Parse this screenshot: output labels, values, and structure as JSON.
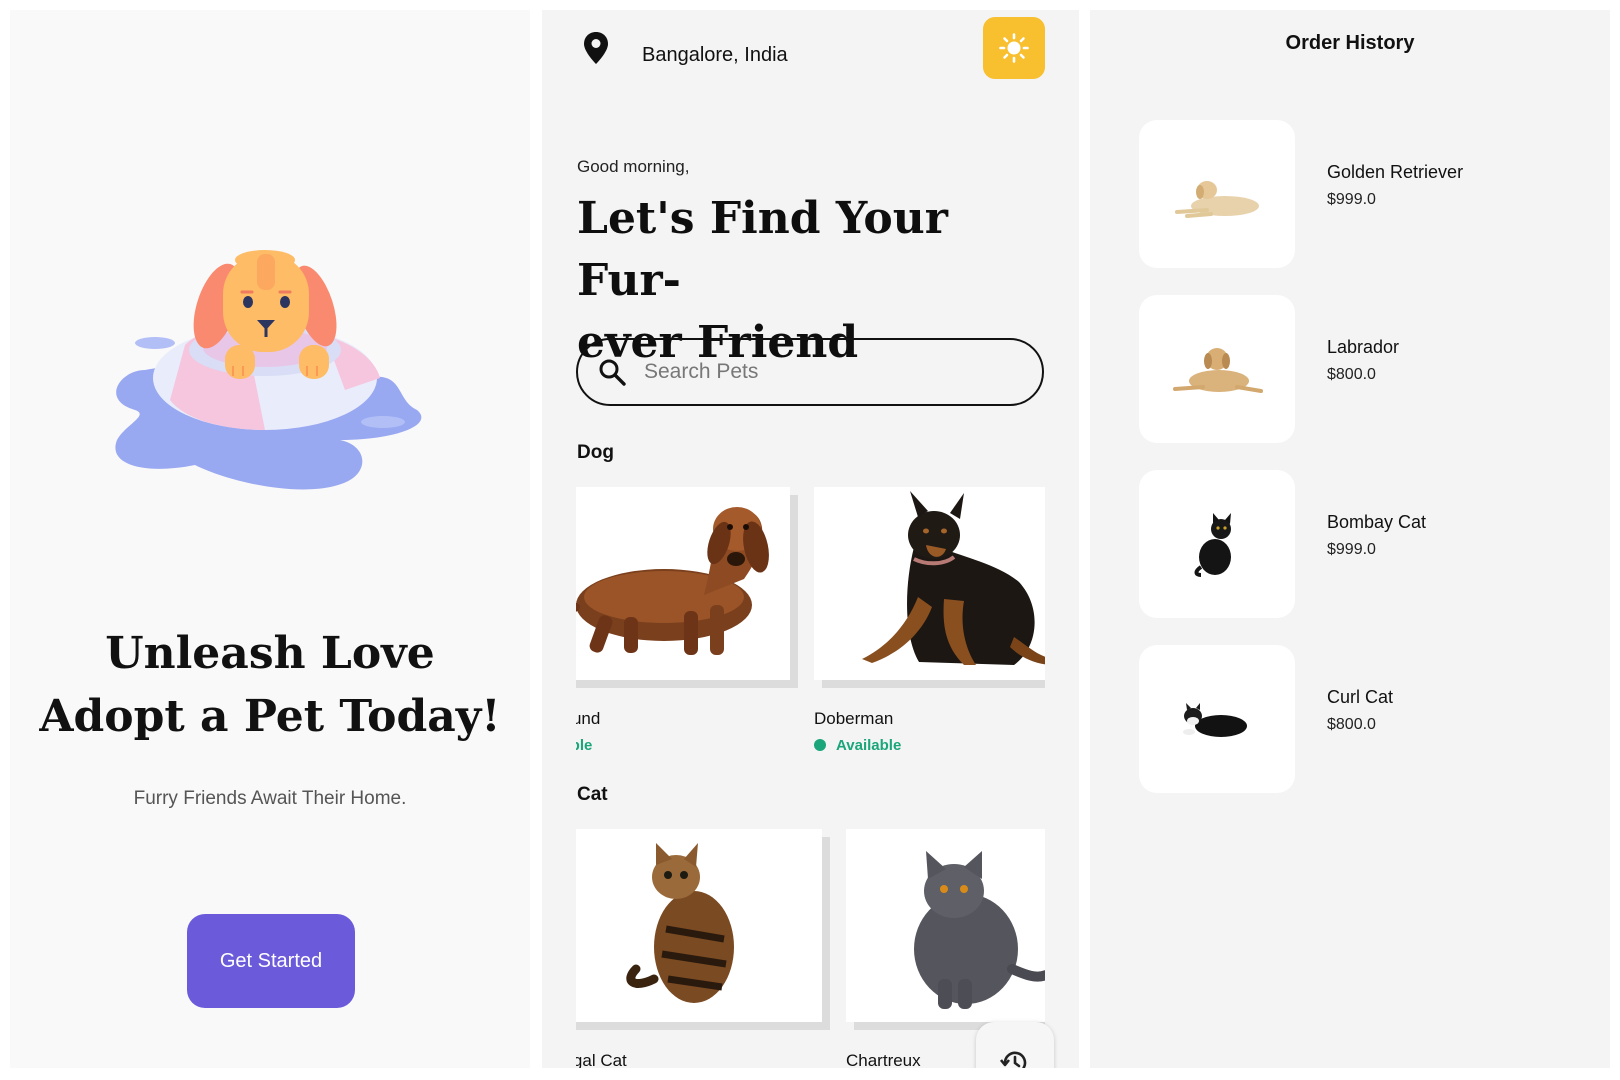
{
  "onboarding": {
    "headline_line1": "Unleash Love",
    "headline_line2": "Adopt a Pet Today!",
    "subtitle": "Furry Friends Await Their Home.",
    "cta_label": "Get Started",
    "hero_icon": "puppy-on-float-illustration",
    "accent_color": "#6b5bdb"
  },
  "home": {
    "location": "Bangalore, India",
    "location_icon": "map-pin-icon",
    "theme_icon": "sun-icon",
    "theme_color": "#f8bf2e",
    "greeting": "Good morning,",
    "title_line1": "Let's Find Your Fur-",
    "title_line2": "ever Friend",
    "search": {
      "placeholder": "Search Pets",
      "value": ""
    },
    "categories": [
      {
        "name": "Dog",
        "pets": [
          {
            "name": "Dachshund",
            "visible_name": "shund",
            "status": "Available",
            "visible_status": "ilable"
          },
          {
            "name": "Doberman",
            "visible_name": "Doberman",
            "status": "Available",
            "visible_status": "Available"
          }
        ]
      },
      {
        "name": "Cat",
        "pets": [
          {
            "name": "Bengal Cat",
            "visible_name": "engal Cat"
          },
          {
            "name": "Chartreux",
            "visible_name": "Chartreux"
          }
        ]
      }
    ],
    "status_color": "#1aa67a",
    "history_icon": "history-icon"
  },
  "orders": {
    "title": "Order History",
    "items": [
      {
        "name": "Golden Retriever",
        "price": "$999.0"
      },
      {
        "name": "Labrador",
        "price": "$800.0"
      },
      {
        "name": "Bombay Cat",
        "price": "$999.0"
      },
      {
        "name": "Curl Cat",
        "price": "$800.0"
      }
    ]
  }
}
